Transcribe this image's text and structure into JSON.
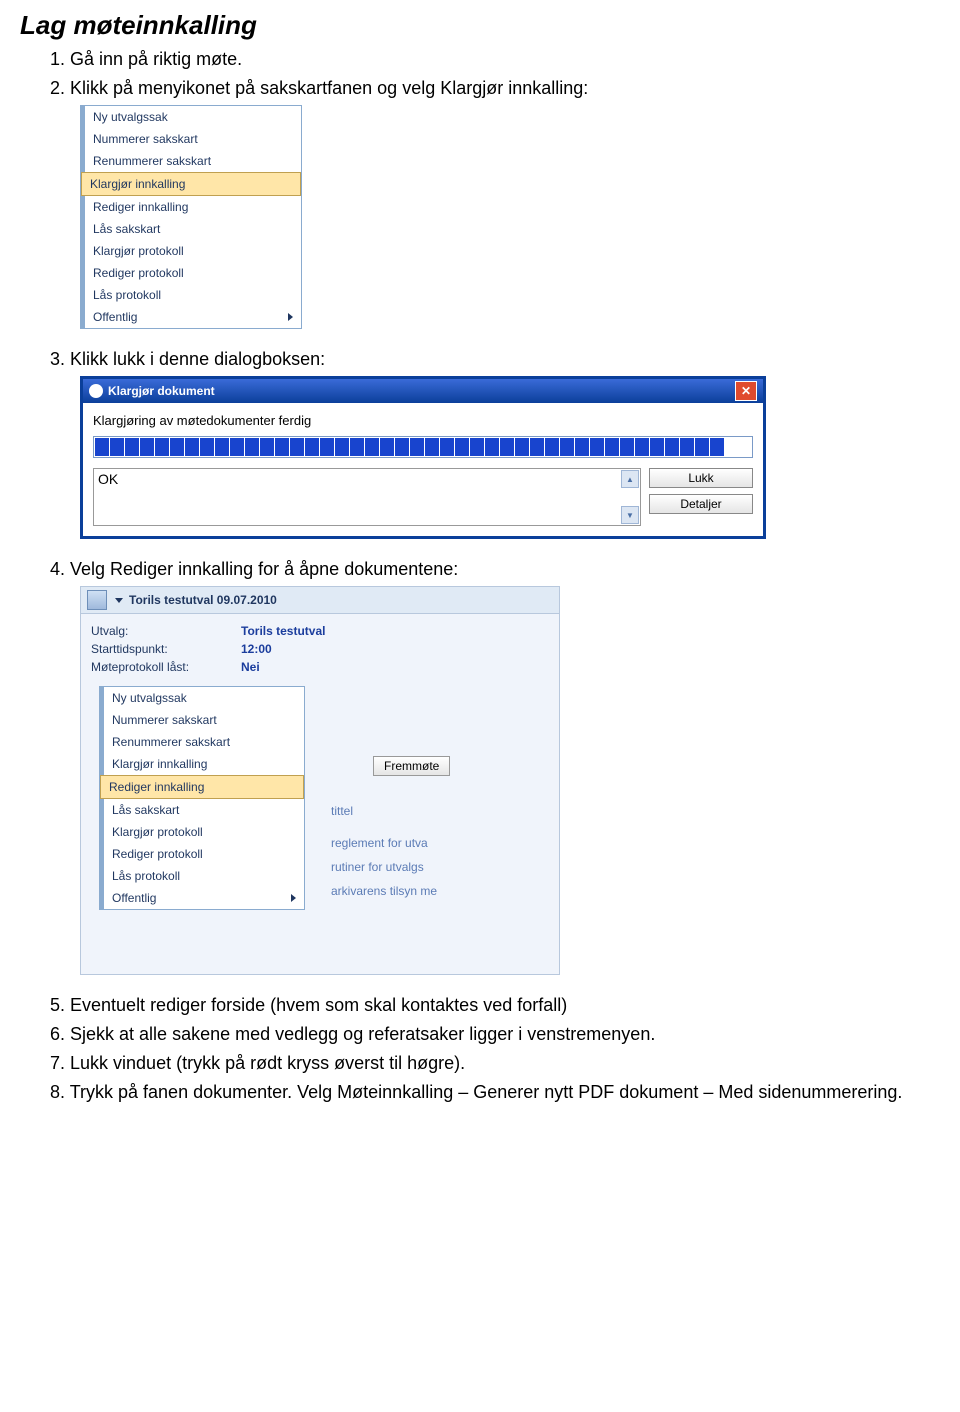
{
  "title": "Lag  møteinnkalling",
  "steps": {
    "s1": "1. Gå inn på riktig møte.",
    "s2": "2. Klikk på menyikonet på sakskartfanen og velg Klargjør innkalling:",
    "s3": "3. Klikk lukk i denne dialogboksen:",
    "s4": "4. Velg  Rediger innkalling for å åpne dokumentene:",
    "s5": "5. Eventuelt rediger forside (hvem som skal kontaktes ved forfall)",
    "s6": "6. Sjekk at alle sakene med vedlegg og referatsaker ligger i venstremenyen.",
    "s7": "7. Lukk vinduet (trykk på rødt kryss øverst til høgre).",
    "s8": "8. Trykk på fanen dokumenter. Velg Møteinnkalling – Generer nytt PDF dokument – Med sidenummerering."
  },
  "menu1": {
    "items": [
      "Ny utvalgssak",
      "Nummerer sakskart",
      "Renummerer sakskart",
      "Klargjør innkalling",
      "Rediger innkalling",
      "Lås sakskart",
      "Klargjør protokoll",
      "Rediger protokoll",
      "Lås protokoll",
      "Offentlig"
    ]
  },
  "dialog": {
    "title": "Klargjør dokument",
    "message": "Klargjøring av møtedokumenter ferdig",
    "ok_text": "OK",
    "btn_close": "Lukk",
    "btn_details": "Detaljer"
  },
  "panel": {
    "header": "Torils testutval  09.07.2010",
    "utvalg_label": "Utvalg:",
    "utvalg_value": "Torils testutval",
    "start_label": "Starttidspunkt:",
    "start_value": "12:00",
    "lock_label": "Møteprotokoll låst:",
    "lock_value": "Nei",
    "button_fremmote": "Fremmøte",
    "bg_texts": {
      "tittel": "tittel",
      "reglement": "reglement for utva",
      "rutiner": "rutiner for utvalgs",
      "arkivarens": "arkivarens tilsyn me"
    }
  },
  "menu2": {
    "items": [
      "Ny utvalgssak",
      "Nummerer sakskart",
      "Renummerer sakskart",
      "Klargjør innkalling",
      "Rediger innkalling",
      "Lås sakskart",
      "Klargjør protokoll",
      "Rediger protokoll",
      "Lås protokoll",
      "Offentlig"
    ]
  }
}
